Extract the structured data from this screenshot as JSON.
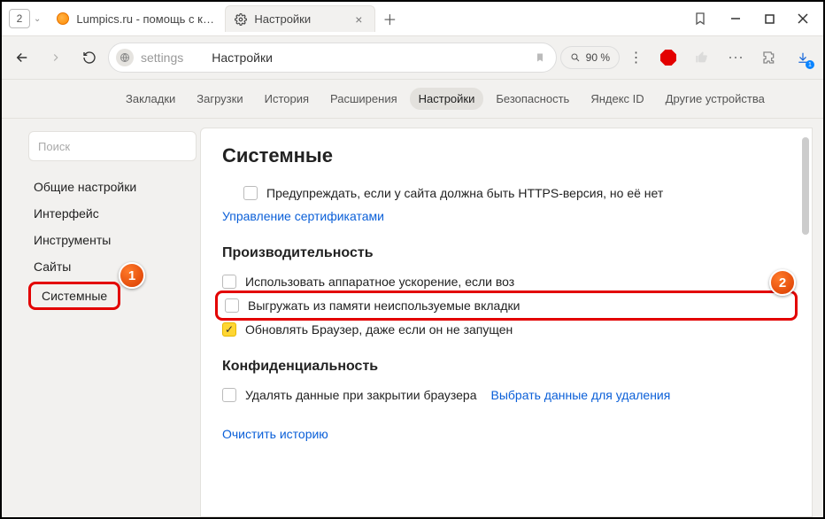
{
  "titlebar": {
    "tab_count": "2",
    "tabs": [
      {
        "title": "Lumpics.ru - помощь с ком"
      },
      {
        "title": "Настройки"
      }
    ]
  },
  "addressbar": {
    "path": "settings",
    "page_title": "Настройки",
    "zoom": "90 %"
  },
  "settings_nav": {
    "items": [
      "Закладки",
      "Загрузки",
      "История",
      "Расширения",
      "Настройки",
      "Безопасность",
      "Яндекс ID",
      "Другие устройства"
    ],
    "active_index": 4
  },
  "sidebar": {
    "search_placeholder": "Поиск",
    "items": [
      "Общие настройки",
      "Интерфейс",
      "Инструменты",
      "Сайты",
      "Системные"
    ],
    "active_index": 4
  },
  "content": {
    "heading": "Системные",
    "https_warn": "Предупреждать, если у сайта должна быть HTTPS-версия, но её нет",
    "manage_certs": "Управление сертификатами",
    "perf_heading": "Производительность",
    "hw_accel": "Использовать аппаратное ускорение, если воз",
    "unload_tabs": "Выгружать из памяти неиспользуемые вкладки",
    "update_bg": "Обновлять Браузер, даже если он не запущен",
    "privacy_heading": "Конфиденциальность",
    "clear_on_close": "Удалять данные при закрытии браузера",
    "choose_data": "Выбрать данные для удаления",
    "clear_history": "Очистить историю"
  },
  "annotations": {
    "b1": "1",
    "b2": "2"
  },
  "download_badge": "1"
}
